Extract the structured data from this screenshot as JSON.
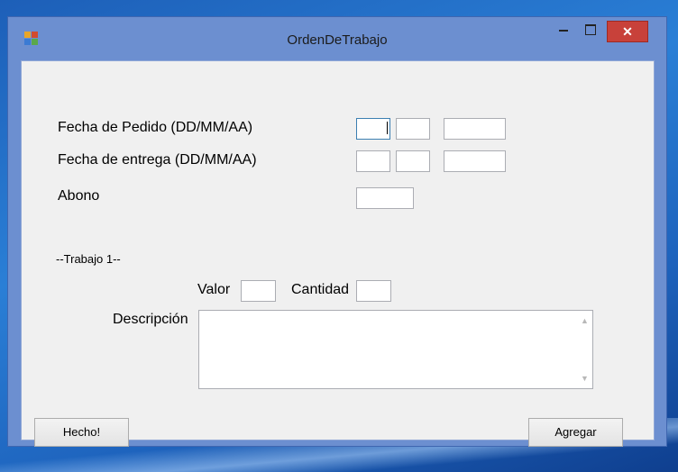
{
  "window": {
    "title": "OrdenDeTrabajo",
    "close_glyph": "✕"
  },
  "form": {
    "fecha_pedido_label": "Fecha de Pedido (DD/MM/AA)",
    "fecha_entrega_label": "Fecha de entrega (DD/MM/AA)",
    "abono_label": "Abono",
    "trabajo_header": "--Trabajo 1--",
    "valor_label": "Valor",
    "cantidad_label": "Cantidad",
    "descripcion_label": "Descripción",
    "fecha_pedido": {
      "day": "",
      "month": "",
      "year": ""
    },
    "fecha_entrega": {
      "day": "",
      "month": "",
      "year": ""
    },
    "abono": "",
    "valor": "",
    "cantidad": "",
    "descripcion": ""
  },
  "buttons": {
    "hecho_label": "Hecho!",
    "agregar_label": "Agregar"
  },
  "icons": {
    "app": "form-app-icon",
    "minimize": "minimize-icon",
    "maximize": "maximize-icon",
    "close": "close-icon",
    "scroll_up": "scroll-up-icon",
    "scroll_down": "scroll-down-icon"
  },
  "colors": {
    "close_button": "#c8413a",
    "window_frame": "#6c8fd0",
    "client_bg": "#f0f0f0"
  }
}
